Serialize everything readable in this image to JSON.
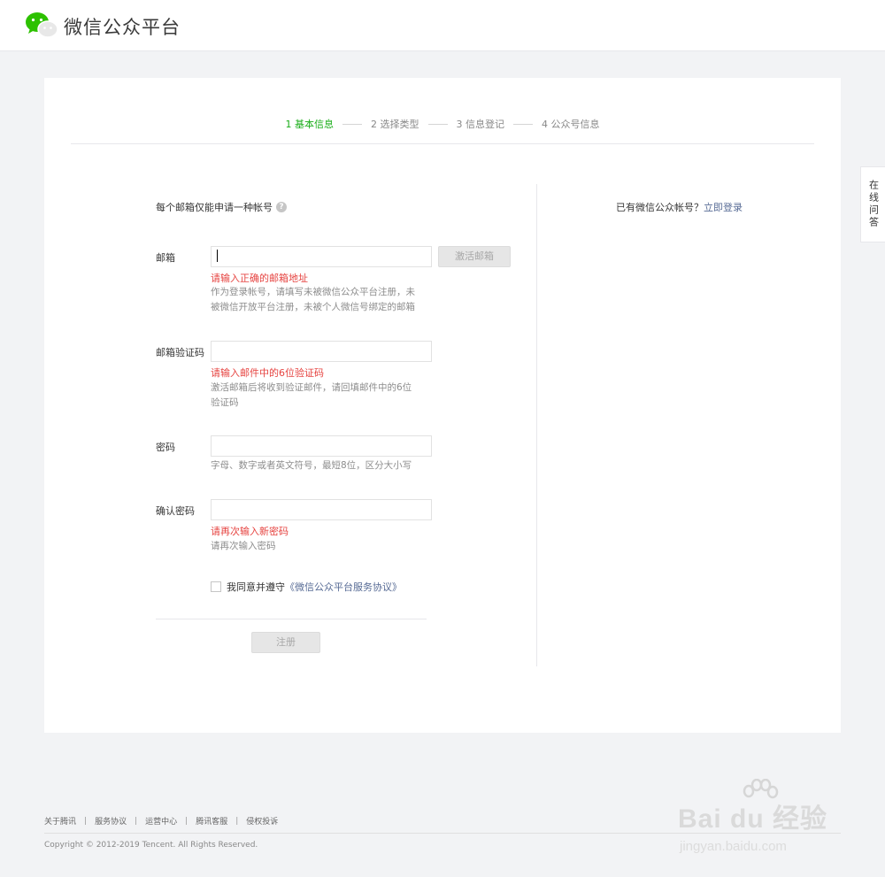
{
  "header": {
    "brand": "微信公众平台",
    "logo_icon": "wechat-logo-icon",
    "brand_color": "#1aad19"
  },
  "steps": [
    {
      "label": "1 基本信息",
      "active": true
    },
    {
      "label": "2 选择类型",
      "active": false
    },
    {
      "label": "3 信息登记",
      "active": false
    },
    {
      "label": "4 公众号信息",
      "active": false
    }
  ],
  "form": {
    "notice": "每个邮箱仅能申请一种帐号",
    "help_icon": "?",
    "email": {
      "label": "邮箱",
      "value": "",
      "activate_button": "激活邮箱",
      "error": "请输入正确的邮箱地址",
      "tip": "作为登录帐号，请填写未被微信公众平台注册，未被微信开放平台注册，未被个人微信号绑定的邮箱"
    },
    "code": {
      "label": "邮箱验证码",
      "value": "",
      "error": "请输入邮件中的6位验证码",
      "tip": "激活邮箱后将收到验证邮件，请回填邮件中的6位验证码"
    },
    "password": {
      "label": "密码",
      "value": "",
      "tip": "字母、数字或者英文符号，最短8位，区分大小写"
    },
    "confirm": {
      "label": "确认密码",
      "value": "",
      "error": "请再次输入新密码",
      "tip": "请再次输入密码"
    },
    "agree_text": "我同意并遵守",
    "agree_link": "《微信公众平台服务协议》",
    "register_button": "注册"
  },
  "side": {
    "login_hint": "已有微信公众帐号？",
    "login_link": "立即登录"
  },
  "side_tab": "在线问答",
  "footer": {
    "links": [
      "关于腾讯",
      "服务协议",
      "运营中心",
      "腾讯客服",
      "侵权投诉"
    ],
    "separator": "|",
    "copyright": "Copyright © 2012-2019 Tencent. All Rights Reserved."
  },
  "watermark": {
    "main": "Bai du 经验",
    "sub": "jingyan.baidu.com"
  },
  "colors": {
    "error": "#e64340",
    "link": "#576b95",
    "active_step": "#1aad19"
  }
}
